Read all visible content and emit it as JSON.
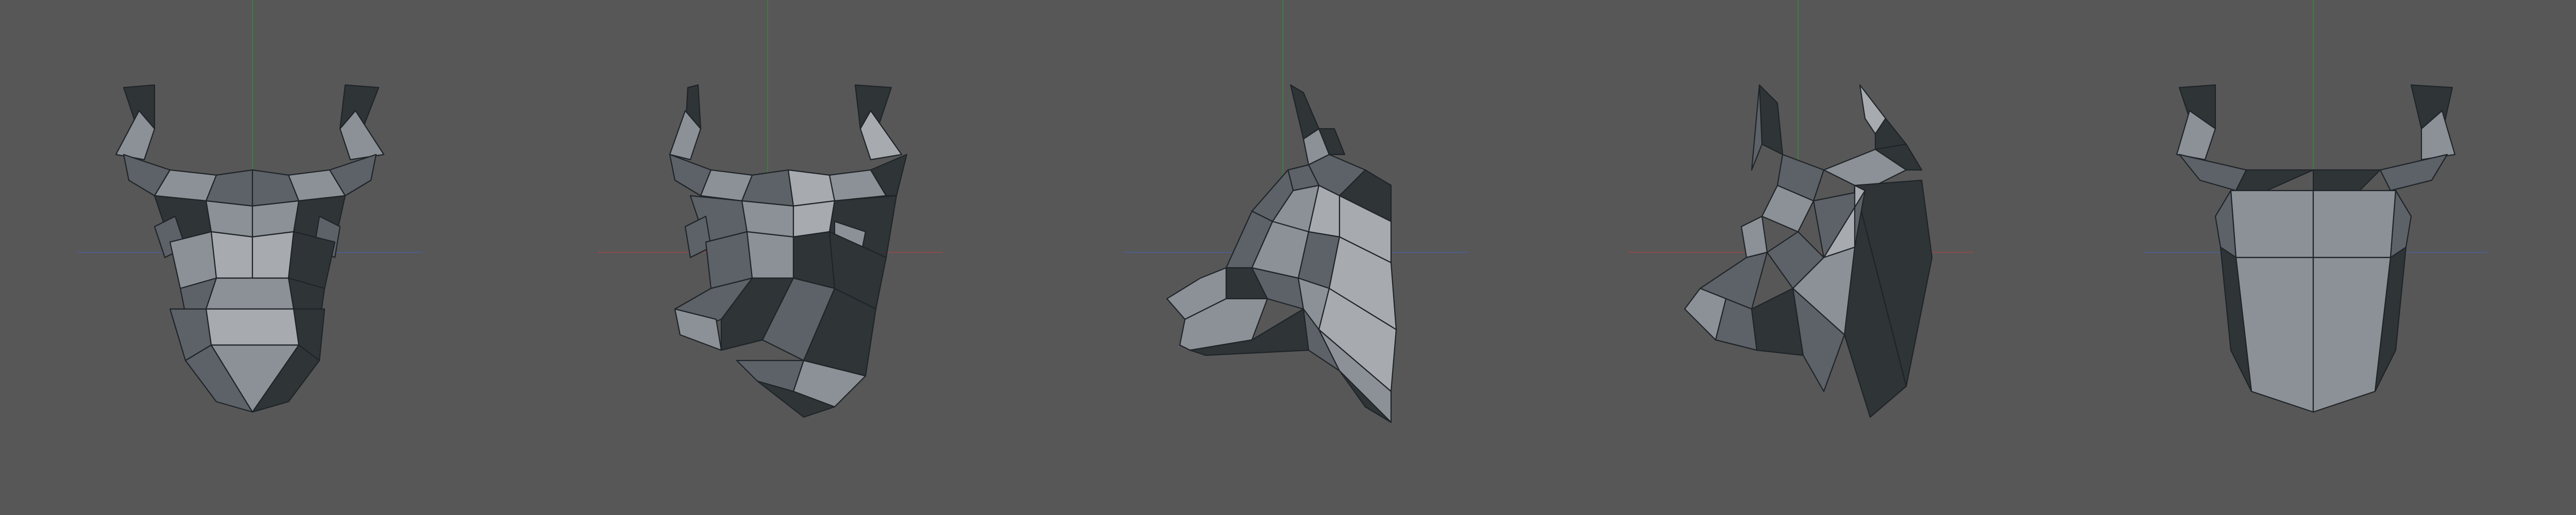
{
  "viewport": {
    "background": "#575757",
    "axis_x_color": "#8a4b4b",
    "axis_y_color": "#3f7a3f",
    "axis_z_color": "#4d5d86"
  },
  "views": [
    {
      "name": "front"
    },
    {
      "name": "three-quarter"
    },
    {
      "name": "side"
    },
    {
      "name": "three-quarter-back"
    },
    {
      "name": "back"
    }
  ],
  "mesh": {
    "tone_dark": "#2f3437",
    "tone_mid": "#5c6268",
    "tone_light": "#8b9196",
    "tone_highlight": "#a7abb0"
  }
}
